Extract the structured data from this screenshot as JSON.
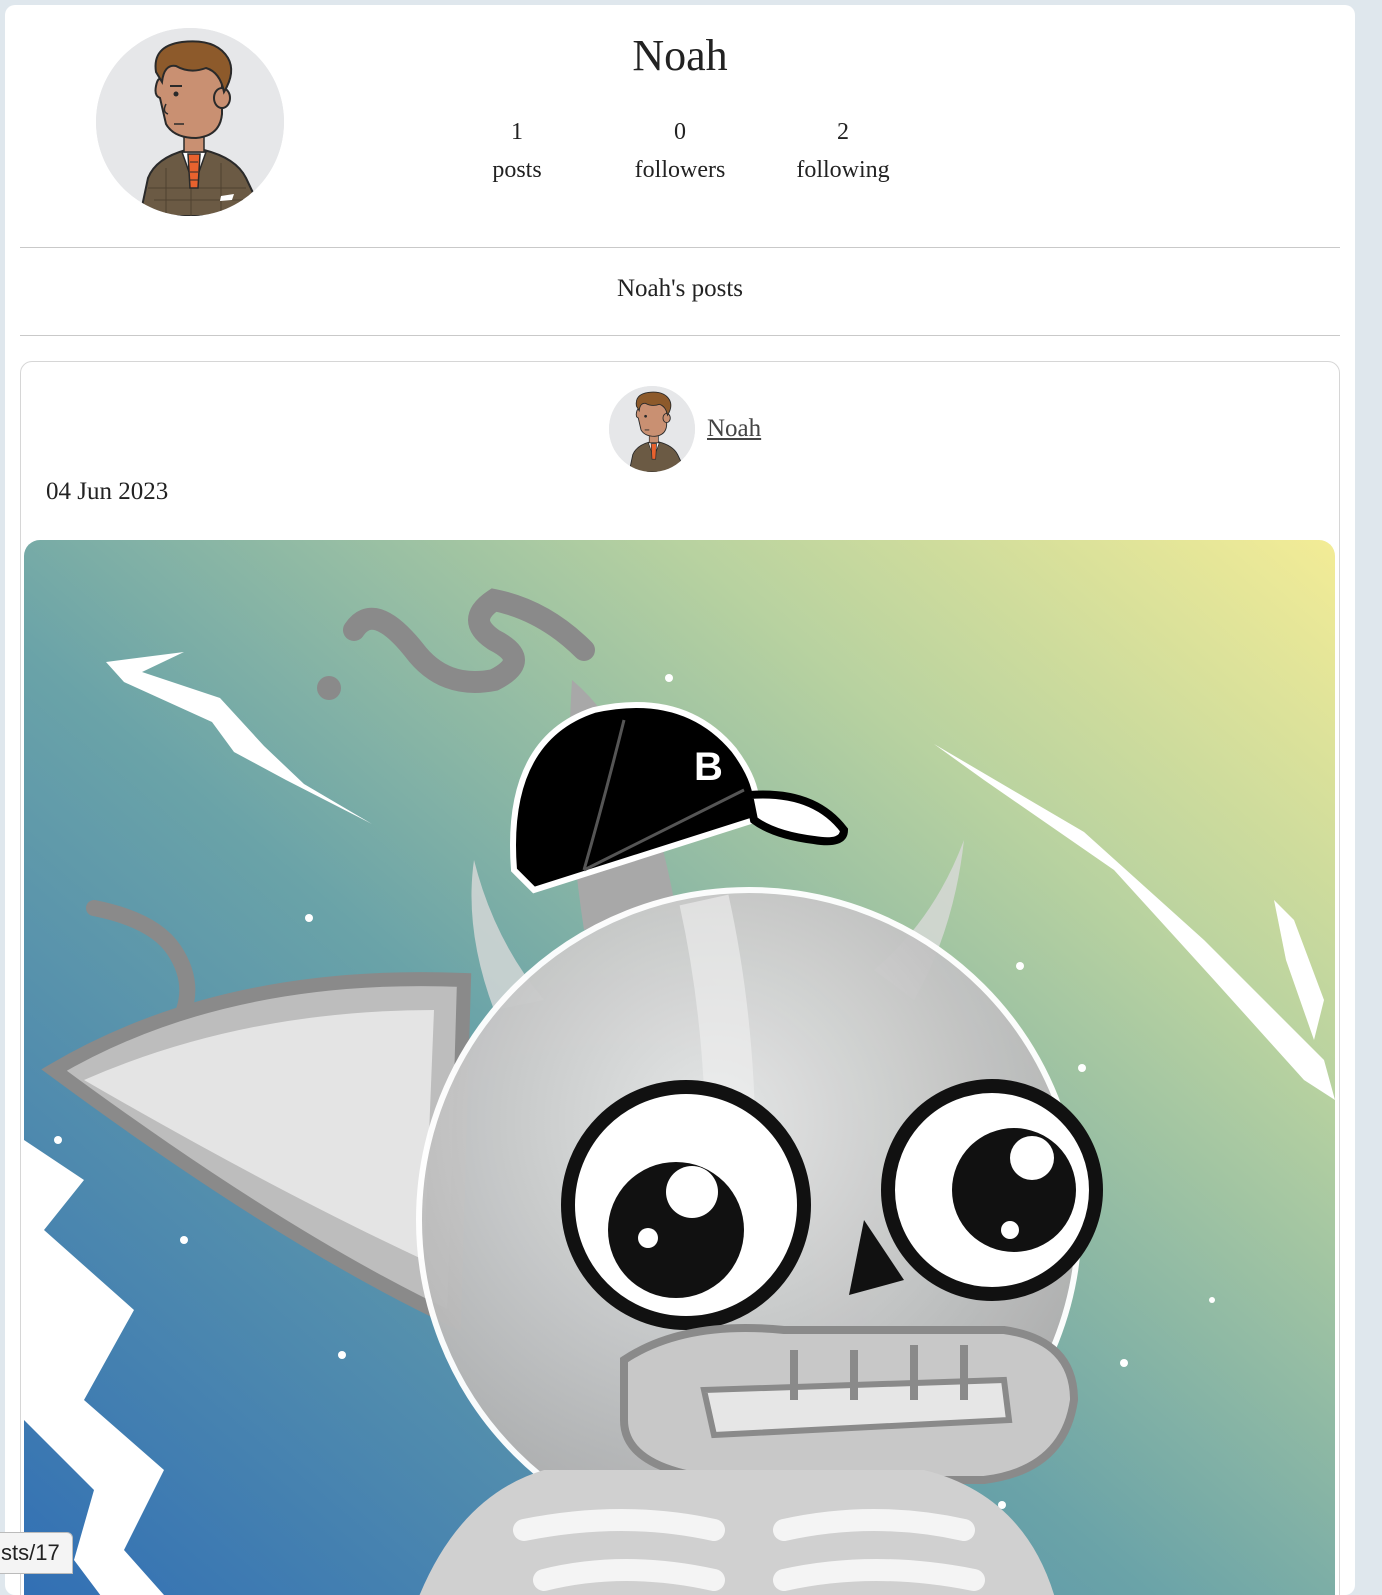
{
  "profile": {
    "name": "Noah",
    "stats": [
      {
        "value": "1",
        "label": "posts"
      },
      {
        "value": "0",
        "label": "followers"
      },
      {
        "value": "2",
        "label": "following"
      }
    ]
  },
  "posts_section": {
    "heading": "Noah's posts"
  },
  "post": {
    "author": "Noah",
    "date": "04 Jun 2023",
    "image": "cartoon-skeleton-cat-with-cap-and-b-logo"
  },
  "status_bar": {
    "url_fragment": "sts/17"
  },
  "colors": {
    "page_bg": "#dfe7ed",
    "card_border": "#d6d6d6",
    "divider": "#c9c9c9",
    "image_bg_blue": "#2f6db5",
    "image_bg_teal": "#6aa3a8",
    "image_bg_yellow": "#f3ec96"
  },
  "icons": {
    "profile_avatar": "cartoon-man-in-tweed-jacket-avatar"
  }
}
